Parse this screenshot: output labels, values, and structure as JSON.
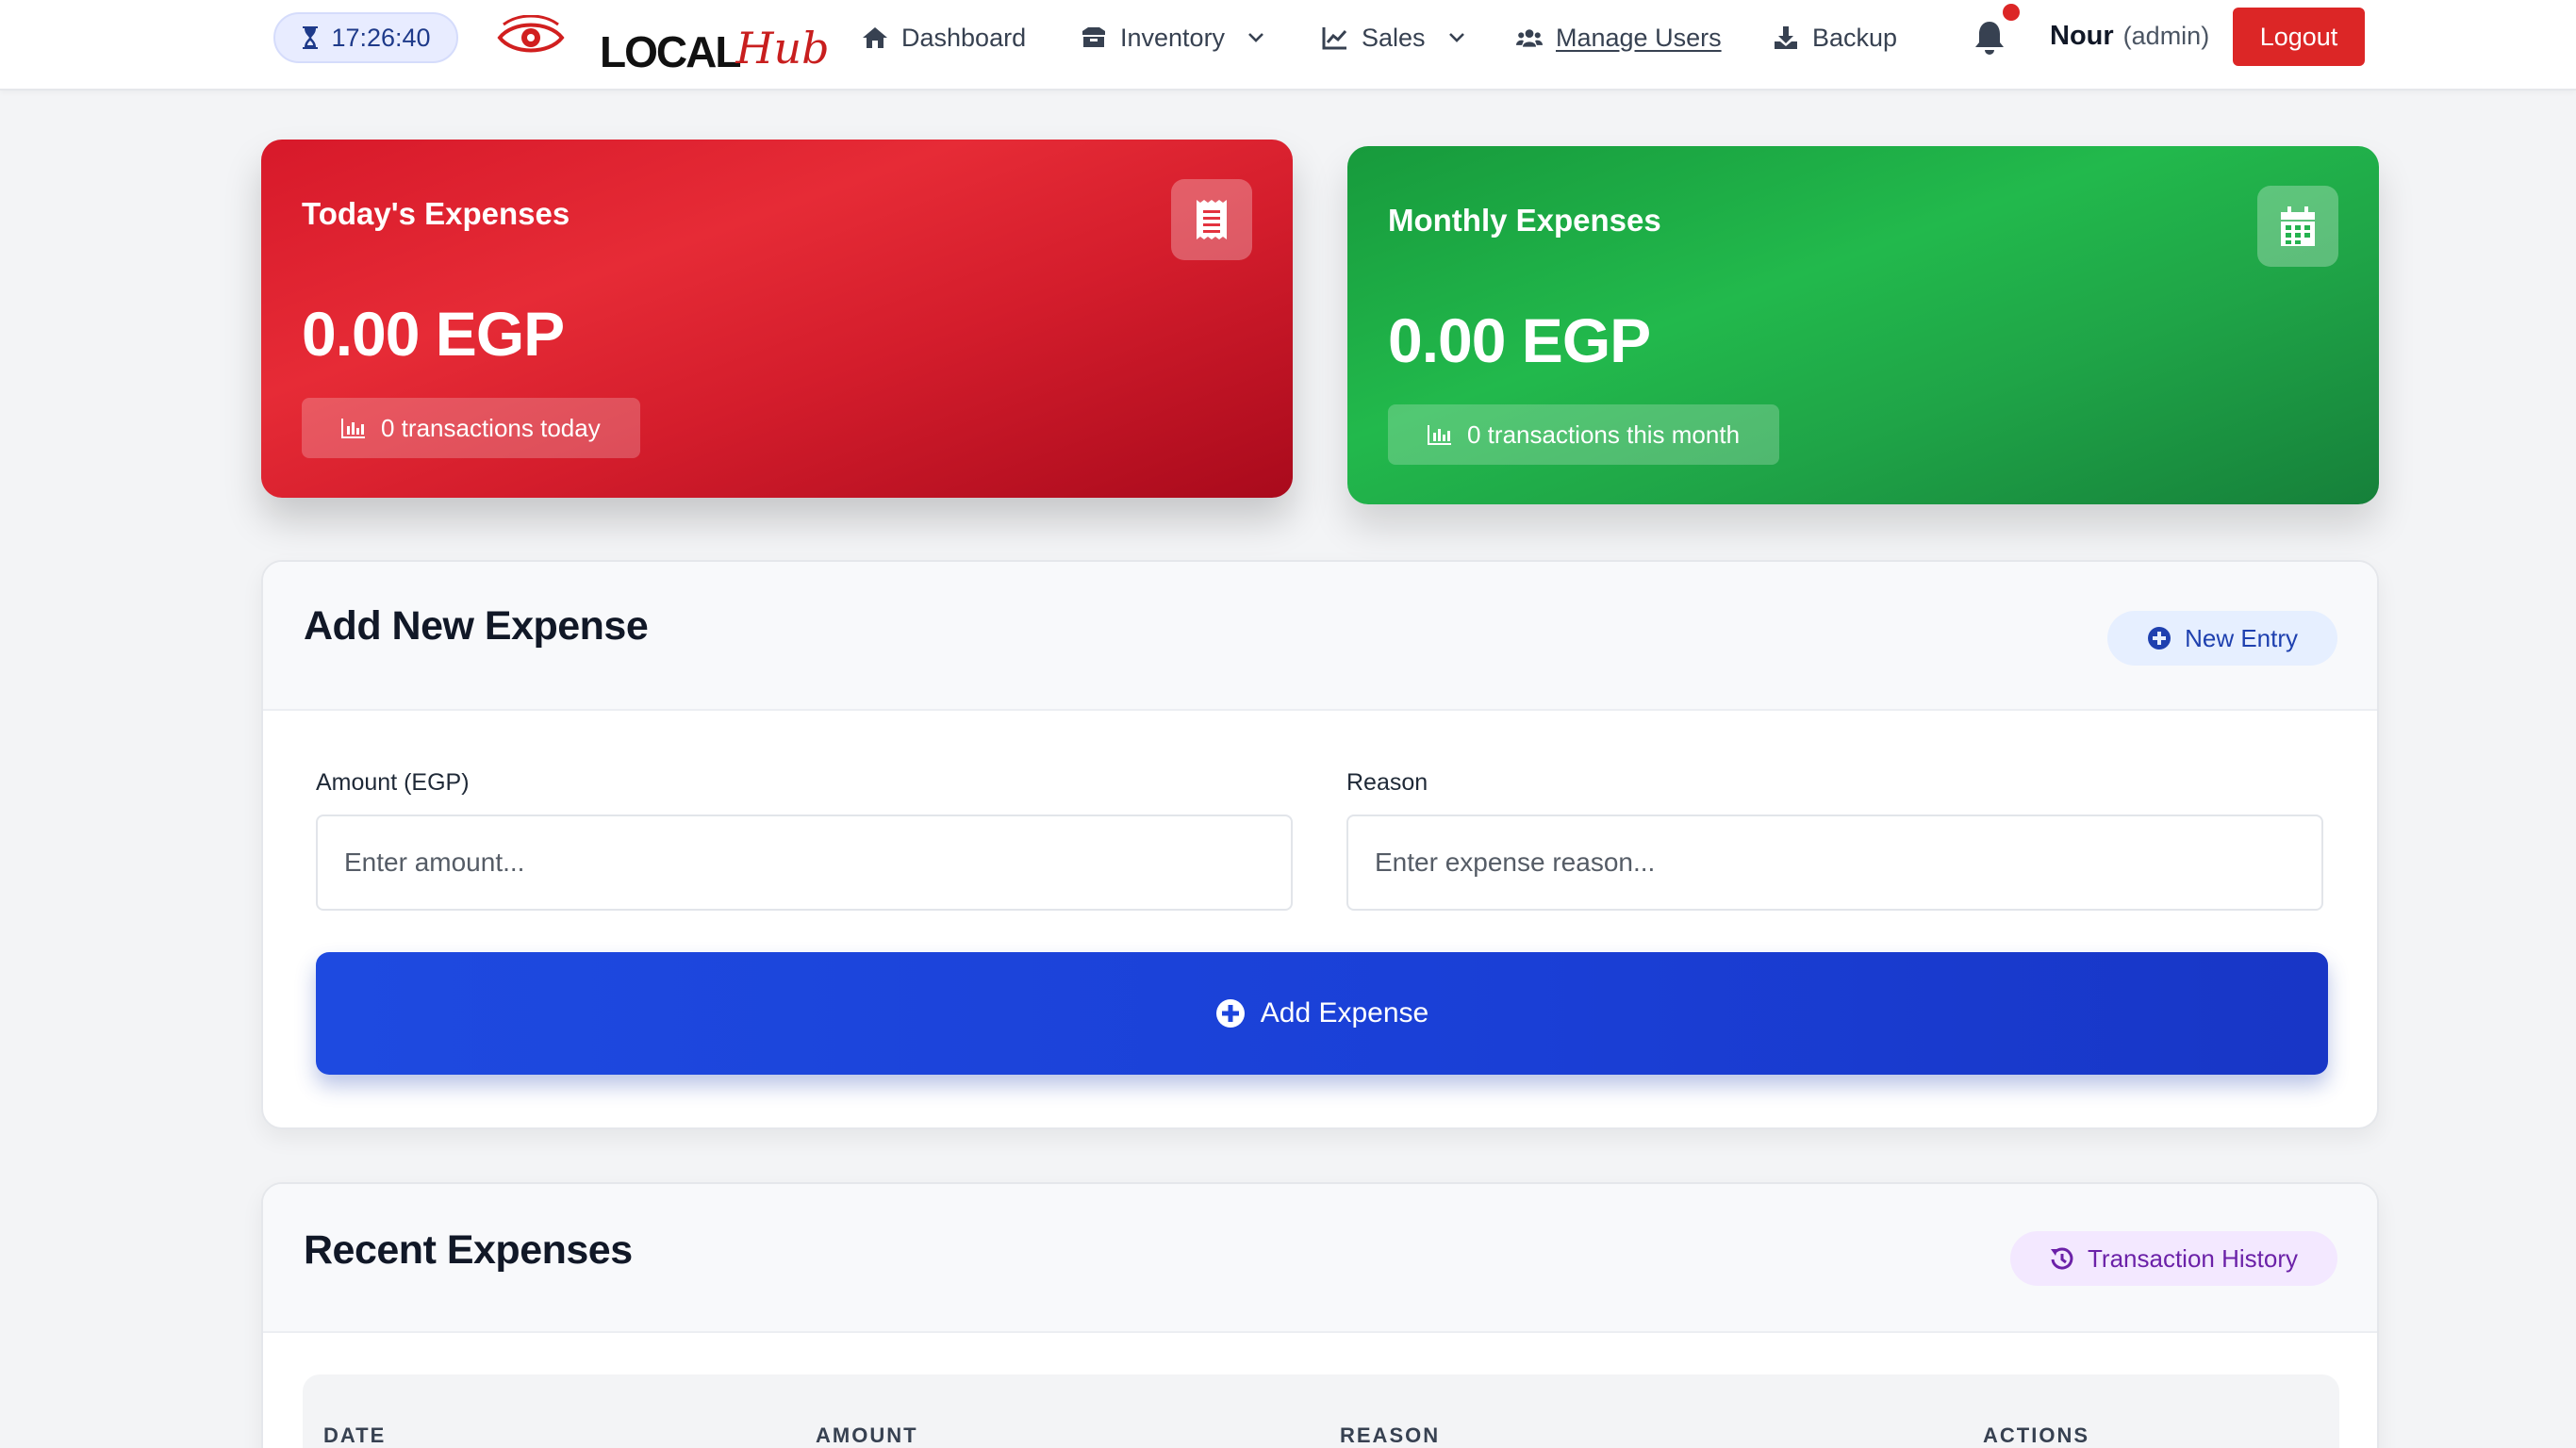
{
  "header": {
    "clock": "17:26:40",
    "logo": {
      "part1": "LOCAL",
      "part2": "Hub"
    },
    "nav": [
      {
        "label": "Dashboard",
        "icon": "home-icon"
      },
      {
        "label": "Inventory",
        "icon": "boxes-icon",
        "dropdown": true
      },
      {
        "label": "Sales",
        "icon": "chart-line-icon",
        "dropdown": true
      },
      {
        "label": "Manage Users",
        "icon": "users-icon"
      },
      {
        "label": "Backup",
        "icon": "download-icon"
      }
    ],
    "user": {
      "name": "Nour",
      "role": "(admin)"
    },
    "logout_label": "Logout",
    "has_notification": true
  },
  "stats": {
    "today": {
      "title": "Today's Expenses",
      "value": "0.00 EGP",
      "note": "0 transactions today",
      "icon": "receipt-icon",
      "color": "#dc2626"
    },
    "monthly": {
      "title": "Monthly Expenses",
      "value": "0.00 EGP",
      "note": "0 transactions this month",
      "icon": "calendar-icon",
      "color": "#16a34a"
    }
  },
  "add_expense": {
    "title": "Add New Expense",
    "new_entry_label": "New Entry",
    "amount": {
      "label": "Amount (EGP)",
      "placeholder": "Enter amount...",
      "value": ""
    },
    "reason": {
      "label": "Reason",
      "placeholder": "Enter expense reason...",
      "value": ""
    },
    "submit_label": "Add Expense",
    "accent": "#1d4ed8"
  },
  "recent": {
    "title": "Recent Expenses",
    "history_label": "Transaction History",
    "columns": [
      "DATE",
      "AMOUNT",
      "REASON",
      "ACTIONS"
    ]
  }
}
